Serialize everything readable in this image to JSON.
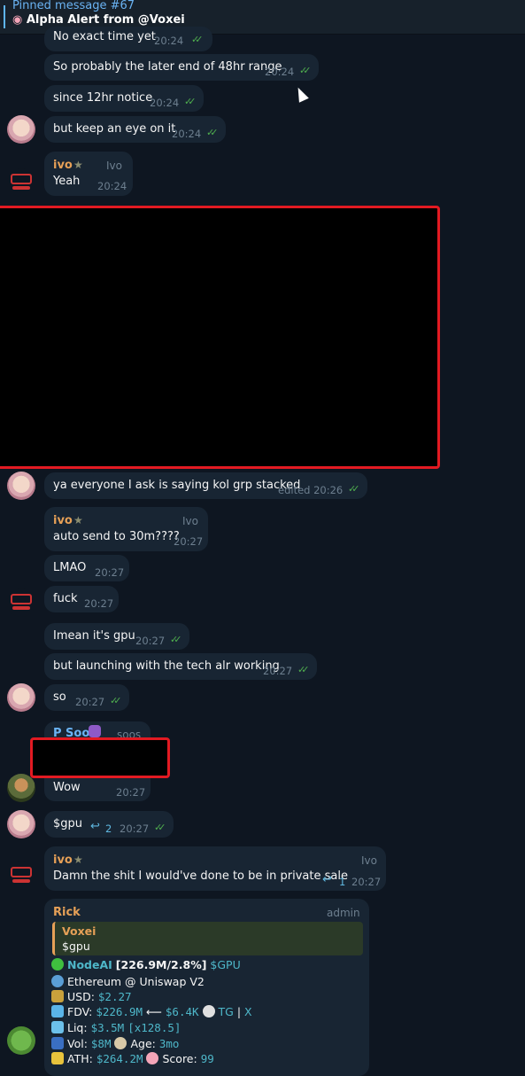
{
  "pinned": {
    "title": "Pinned message #67",
    "text": "Alpha Alert from @Voxei"
  },
  "messages": {
    "m1": {
      "text": "No exact time yet",
      "time": "20:24"
    },
    "m2": {
      "text": "So probably the later end of 48hr range",
      "time": "20:24"
    },
    "m3": {
      "text": "since 12hr notice",
      "time": "20:24"
    },
    "m4": {
      "text": "but keep an eye on it",
      "time": "20:24"
    },
    "m5": {
      "sender": "ivo",
      "role": "Ivo",
      "text": "Yeah",
      "time": "20:24"
    },
    "m6": {
      "text": "ya everyone I ask is saying kol grp stacked",
      "time": "edited 20:26"
    },
    "m7": {
      "sender": "ivo",
      "role": "Ivo",
      "text": "auto send to 30m????",
      "time": "20:27"
    },
    "m8": {
      "text": "LMAO",
      "time": "20:27"
    },
    "m9": {
      "text": "fuck",
      "time": "20:27"
    },
    "m10": {
      "text": "Imean it's gpu",
      "time": "20:27"
    },
    "m11": {
      "text": "but launching with the tech alr working",
      "time": "20:27"
    },
    "m12": {
      "text": "so",
      "time": "20:27"
    },
    "m13": {
      "sender": "P Soos",
      "role": "soos",
      "text": "Wow",
      "time": "20:27"
    },
    "m14": {
      "text": "$gpu",
      "replies": "2",
      "time": "20:27"
    },
    "m15": {
      "sender": "ivo",
      "role": "Ivo",
      "text": "Damn the shit I would've done to be in private sale",
      "replies": "1",
      "time": "20:27"
    }
  },
  "rick": {
    "sender": "Rick",
    "role": "admin",
    "quote_name": "Voxei",
    "quote_text": "$gpu",
    "l1_name": "NodeAI",
    "l1_stats": "[226.9M/2.8%]",
    "l1_ticker": "$GPU",
    "l2": "Ethereum @ Uniswap V2",
    "l3_label": "USD:",
    "l3_val": "$2.27",
    "l4_label": "FDV:",
    "l4_val": "$226.9M",
    "l4_arrow": "⟵",
    "l4_val2": "$6.4K",
    "l4_tg": "TG",
    "l4_sep": "|",
    "l4_x": "X",
    "l5_label": "Liq:",
    "l5_val": "$3.5M",
    "l5_mult": "[x128.5]",
    "l6_label": "Vol:",
    "l6_val": "$8M",
    "l6_age": "Age:",
    "l6_age_val": "3mo",
    "l7_label": "ATH:",
    "l7_val": "$264.2M",
    "l7_score": "Score:",
    "l7_score_val": "99"
  },
  "colors": {
    "accent": "#6ab3f3",
    "sender": "#e6a057",
    "check": "#4fae4e",
    "redaction_border": "#e21a22"
  }
}
